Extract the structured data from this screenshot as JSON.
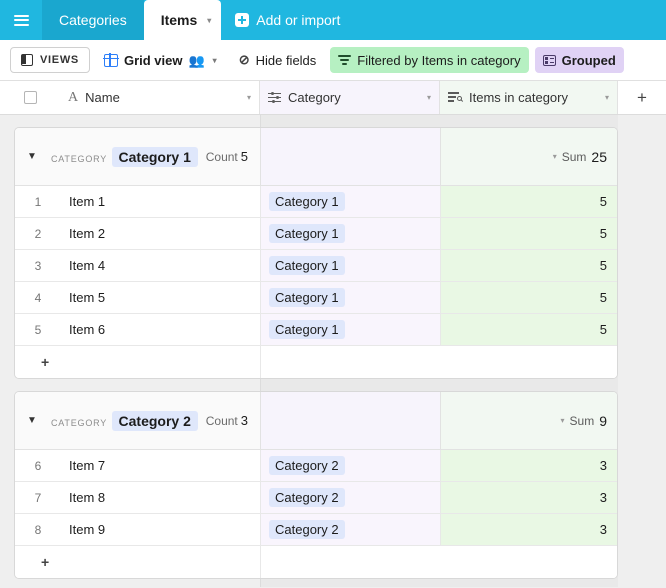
{
  "tabbar": {
    "menu_icon": "hamburger-icon",
    "tabs": [
      {
        "label": "Categories",
        "active": false
      },
      {
        "label": "Items",
        "active": true
      }
    ],
    "tab_caret": "▾",
    "add_or_import": "Add or import"
  },
  "toolbar": {
    "views_label": "VIEWS",
    "grid_view_label": "Grid view",
    "collaborators_icon": "people-icon",
    "grid_caret": "▾",
    "hide_fields_label": "Hide fields",
    "hide_fields_icon": "hide-fields-icon",
    "filter_label": "Filtered by Items in category",
    "filter_color": "#b6f0c2",
    "group_label": "Grouped",
    "group_color": "#e0d2f5"
  },
  "columns": {
    "select_all_checkbox": "select-all-checkbox",
    "name": {
      "label": "Name",
      "icon": "text-field-icon",
      "caret": "▾"
    },
    "category": {
      "label": "Category",
      "icon": "linked-record-icon",
      "caret": "▾",
      "bg": "#f7f4fc"
    },
    "items_in_category": {
      "label": "Items in category",
      "icon": "lookup-icon",
      "caret": "▾",
      "bg": "#f2f8f2"
    },
    "add_field": "+"
  },
  "groups": [
    {
      "field_label": "CATEGORY",
      "value": "Category 1",
      "toggle": "▼",
      "count_label": "Count",
      "count_value": "5",
      "summary_caret": "▾",
      "summary_label": "Sum",
      "summary_value": "25",
      "rows": [
        {
          "num": "1",
          "name": "Item 1",
          "category": "Category 1",
          "items_in_category": "5"
        },
        {
          "num": "2",
          "name": "Item 2",
          "category": "Category 1",
          "items_in_category": "5"
        },
        {
          "num": "3",
          "name": "Item 4",
          "category": "Category 1",
          "items_in_category": "5"
        },
        {
          "num": "4",
          "name": "Item 5",
          "category": "Category 1",
          "items_in_category": "5"
        },
        {
          "num": "5",
          "name": "Item 6",
          "category": "Category 1",
          "items_in_category": "5"
        }
      ],
      "add_row": "+"
    },
    {
      "field_label": "CATEGORY",
      "value": "Category 2",
      "toggle": "▼",
      "count_label": "Count",
      "count_value": "3",
      "summary_caret": "▾",
      "summary_label": "Sum",
      "summary_value": "9",
      "rows": [
        {
          "num": "6",
          "name": "Item 7",
          "category": "Category 2",
          "items_in_category": "3"
        },
        {
          "num": "7",
          "name": "Item 8",
          "category": "Category 2",
          "items_in_category": "3"
        },
        {
          "num": "8",
          "name": "Item 9",
          "category": "Category 2",
          "items_in_category": "3"
        }
      ],
      "add_row": "+"
    }
  ],
  "theme": {
    "tabbar_bg": "#20b7e0",
    "tab_inactive_bg": "#1aa7cf",
    "chip_bg": "#dfe7fb",
    "category_col_bg": "#f9f5fd",
    "rollup_col_bg": "#e9f8e4"
  }
}
